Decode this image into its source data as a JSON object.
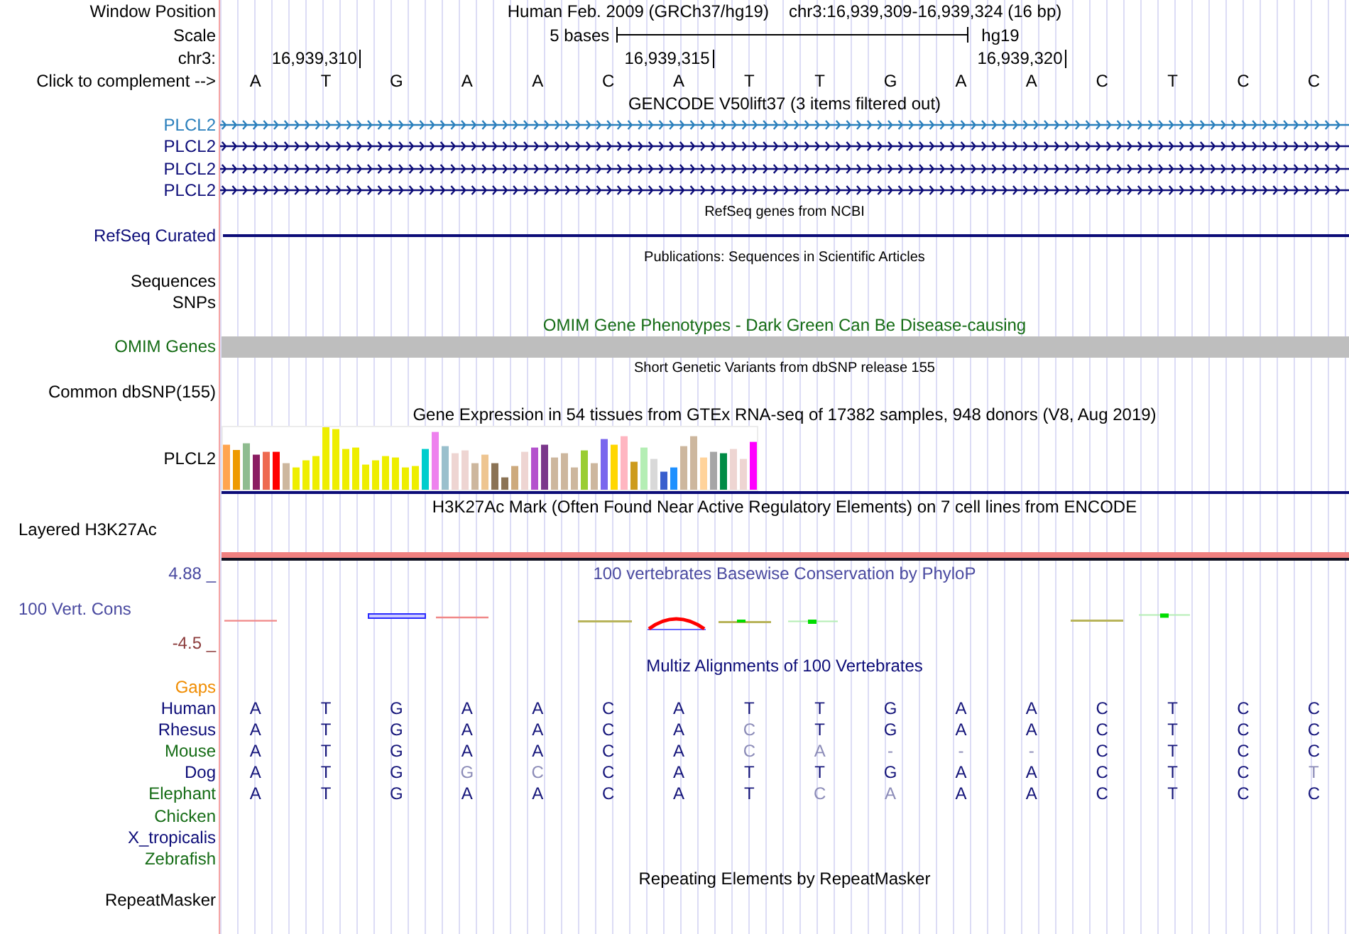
{
  "header": {
    "position_label": "Window Position",
    "assembly": "Human Feb. 2009 (GRCh37/hg19)",
    "position": "chr3:16,939,309-16,939,324 (16 bp)",
    "scale_label": "Scale",
    "scale": "5 bases",
    "scale_assembly": "hg19",
    "chrom_label": "chr3:",
    "ruler_ticks": [
      "16,939,310",
      "16,939,315",
      "16,939,320"
    ],
    "complement_label": "Click to complement -->",
    "bases": [
      "A",
      "T",
      "G",
      "A",
      "A",
      "C",
      "A",
      "T",
      "T",
      "G",
      "A",
      "A",
      "C",
      "T",
      "C",
      "C"
    ]
  },
  "tracks": [
    {
      "kind": "genes",
      "title": "GENCODE V50lift37 (3 items filtered out)",
      "items": [
        {
          "label": "PLCL2",
          "color": "#2a7fbc"
        },
        {
          "label": "PLCL2",
          "color": "#0c0c78"
        },
        {
          "label": "PLCL2",
          "color": "#0c0c78"
        },
        {
          "label": "PLCL2",
          "color": "#0c0c78"
        }
      ]
    },
    {
      "kind": "line",
      "title": "RefSeq genes from NCBI",
      "label": "RefSeq Curated",
      "color": "#0c0c78"
    },
    {
      "kind": "sparse",
      "title": "Publications: Sequences in Scientific Articles",
      "labels": [
        "Sequences",
        "SNPs"
      ],
      "color": "#000000"
    },
    {
      "kind": "bar",
      "title": "OMIM Gene Phenotypes - Dark Green Can Be Disease-causing",
      "label": "OMIM Genes",
      "color": "#156c15"
    },
    {
      "kind": "sparse",
      "title": "Short Genetic Variants from dbSNP release 155",
      "labels": [
        "Common dbSNP(155)"
      ],
      "color": "#000000"
    },
    {
      "kind": "expression",
      "title": "Gene Expression in 54 tissues from GTEx RNA-seq of 17382 samples, 948 donors (V8, Aug 2019)",
      "label": "PLCL2",
      "color": "#000000"
    },
    {
      "kind": "layered",
      "title": "H3K27Ac Mark (Often Found Near Active Regulatory Elements) on 7 cell lines from ENCODE",
      "label": "Layered H3K27Ac",
      "color": "#000000"
    },
    {
      "kind": "wiggle",
      "title": "100 vertebrates Basewise Conservation by PhyloP",
      "label": "100 Vert. Cons",
      "color": "#4a4aa0",
      "max_label": "4.88 _",
      "min_label": "-4.5 _"
    },
    {
      "kind": "multiz",
      "title": "Multiz Alignments of 100 Vertebrates",
      "color": "#0c0c78",
      "gaps": {
        "label": "Gaps",
        "color": "#f08c00"
      },
      "species": [
        {
          "name": "Human",
          "color": "#0c0c78",
          "bases": [
            {
              "base": "A",
              "differs": false
            },
            {
              "base": "T",
              "differs": false
            },
            {
              "base": "G",
              "differs": false
            },
            {
              "base": "A",
              "differs": false
            },
            {
              "base": "A",
              "differs": false
            },
            {
              "base": "C",
              "differs": false
            },
            {
              "base": "A",
              "differs": false
            },
            {
              "base": "T",
              "differs": false
            },
            {
              "base": "T",
              "differs": false
            },
            {
              "base": "G",
              "differs": false
            },
            {
              "base": "A",
              "differs": false
            },
            {
              "base": "A",
              "differs": false
            },
            {
              "base": "C",
              "differs": false
            },
            {
              "base": "T",
              "differs": false
            },
            {
              "base": "C",
              "differs": false
            },
            {
              "base": "C",
              "differs": false
            }
          ]
        },
        {
          "name": "Rhesus",
          "color": "#0c0c78",
          "bases": [
            {
              "base": "A",
              "differs": false
            },
            {
              "base": "T",
              "differs": false
            },
            {
              "base": "G",
              "differs": false
            },
            {
              "base": "A",
              "differs": false
            },
            {
              "base": "A",
              "differs": false
            },
            {
              "base": "C",
              "differs": false
            },
            {
              "base": "A",
              "differs": false
            },
            {
              "base": "C",
              "differs": true
            },
            {
              "base": "T",
              "differs": false
            },
            {
              "base": "G",
              "differs": false
            },
            {
              "base": "A",
              "differs": false
            },
            {
              "base": "A",
              "differs": false
            },
            {
              "base": "C",
              "differs": false
            },
            {
              "base": "T",
              "differs": false
            },
            {
              "base": "C",
              "differs": false
            },
            {
              "base": "C",
              "differs": false
            }
          ]
        },
        {
          "name": "Mouse",
          "color": "#156c15",
          "bases": [
            {
              "base": "A",
              "differs": false
            },
            {
              "base": "T",
              "differs": false
            },
            {
              "base": "G",
              "differs": false
            },
            {
              "base": "A",
              "differs": false
            },
            {
              "base": "A",
              "differs": false
            },
            {
              "base": "C",
              "differs": false
            },
            {
              "base": "A",
              "differs": false
            },
            {
              "base": "C",
              "differs": true
            },
            {
              "base": "A",
              "differs": true
            },
            {
              "base": "-",
              "differs": true
            },
            {
              "base": "-",
              "differs": true
            },
            {
              "base": "-",
              "differs": true
            },
            {
              "base": "C",
              "differs": false
            },
            {
              "base": "T",
              "differs": false
            },
            {
              "base": "C",
              "differs": false
            },
            {
              "base": "C",
              "differs": false
            }
          ]
        },
        {
          "name": "Dog",
          "color": "#0c0c78",
          "bases": [
            {
              "base": "A",
              "differs": false
            },
            {
              "base": "T",
              "differs": false
            },
            {
              "base": "G",
              "differs": false
            },
            {
              "base": "G",
              "differs": true
            },
            {
              "base": "C",
              "differs": true
            },
            {
              "base": "C",
              "differs": false
            },
            {
              "base": "A",
              "differs": false
            },
            {
              "base": "T",
              "differs": false
            },
            {
              "base": "T",
              "differs": false
            },
            {
              "base": "G",
              "differs": false
            },
            {
              "base": "A",
              "differs": false
            },
            {
              "base": "A",
              "differs": false
            },
            {
              "base": "C",
              "differs": false
            },
            {
              "base": "T",
              "differs": false
            },
            {
              "base": "C",
              "differs": false
            },
            {
              "base": "T",
              "differs": true
            }
          ]
        },
        {
          "name": "Elephant",
          "color": "#156c15",
          "bases": [
            {
              "base": "A",
              "differs": false
            },
            {
              "base": "T",
              "differs": false
            },
            {
              "base": "G",
              "differs": false
            },
            {
              "base": "A",
              "differs": false
            },
            {
              "base": "A",
              "differs": false
            },
            {
              "base": "C",
              "differs": false
            },
            {
              "base": "A",
              "differs": false
            },
            {
              "base": "T",
              "differs": false
            },
            {
              "base": "C",
              "differs": true
            },
            {
              "base": "A",
              "differs": true
            },
            {
              "base": "A",
              "differs": false
            },
            {
              "base": "A",
              "differs": false
            },
            {
              "base": "C",
              "differs": false
            },
            {
              "base": "T",
              "differs": false
            },
            {
              "base": "C",
              "differs": false
            },
            {
              "base": "C",
              "differs": false
            }
          ]
        },
        {
          "name": "Chicken",
          "color": "#156c15"
        },
        {
          "name": "X_tropicalis",
          "color": "#0c0c78"
        },
        {
          "name": "Zebrafish",
          "color": "#156c15"
        }
      ]
    },
    {
      "kind": "empty",
      "title": "Repeating Elements by RepeatMasker",
      "labels": [
        "RepeatMasker"
      ],
      "color": "#000000"
    }
  ]
}
